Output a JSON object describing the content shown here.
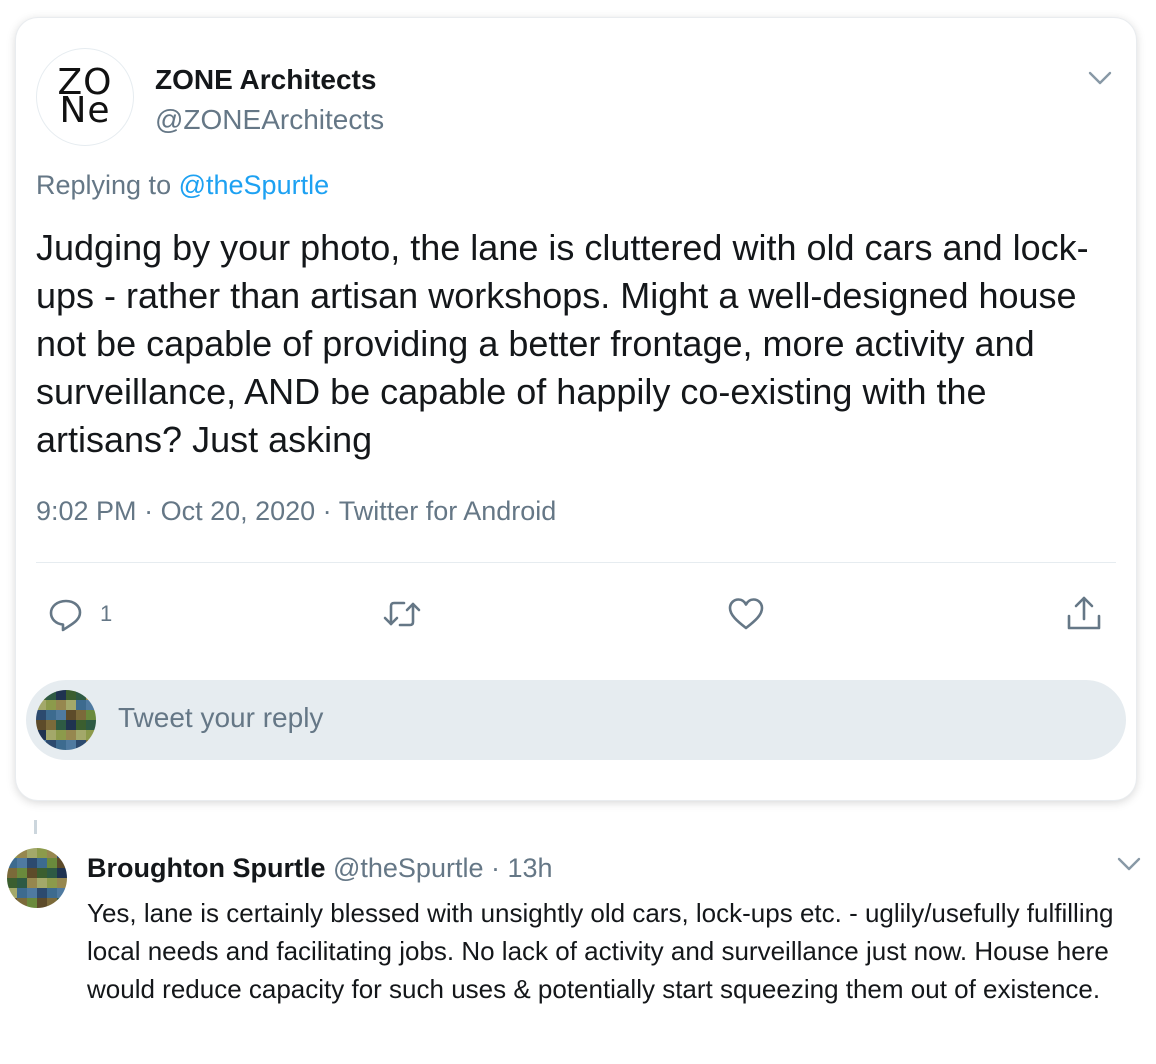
{
  "main_tweet": {
    "author": {
      "avatar_text_line1": "ZO",
      "avatar_text_line2": "Ne",
      "name": "ZONE Architects",
      "handle": "@ZONEArchitects"
    },
    "menu_icon": "chevron-down-icon",
    "replying_prefix": "Replying to",
    "replying_to": "@theSpurtle",
    "text": "Judging by your photo, the lane is cluttered with old cars and lock-ups - rather than artisan workshops. Might a well-designed house not be capable of providing a better frontage, more activity and surveillance, AND be capable of happily co-existing with the artisans? Just asking",
    "time": "9:02 PM",
    "date": "Oct 20, 2020",
    "source": "Twitter for Android",
    "separator": " · ",
    "actions": {
      "reply_count": "1",
      "icons": [
        "reply-icon",
        "retweet-icon",
        "like-icon",
        "share-icon"
      ]
    }
  },
  "reply_composer": {
    "placeholder": "Tweet your reply"
  },
  "reply": {
    "name": "Broughton Spurtle",
    "handle": "@theSpurtle",
    "separator": " · ",
    "time": "13h",
    "text": "Yes, lane is certainly blessed with unsightly old cars, lock-ups etc. - uglily/usefully fulfilling local needs and facilitating jobs. No lack of activity and surveillance just now. House here would reduce capacity for such uses & potentially start squeezing them out of existence."
  },
  "colors": {
    "text_primary": "#14171a",
    "text_secondary": "#657786",
    "link": "#1da1f2",
    "composer_bg": "#e6ecf0",
    "border": "#e6ecf0"
  }
}
